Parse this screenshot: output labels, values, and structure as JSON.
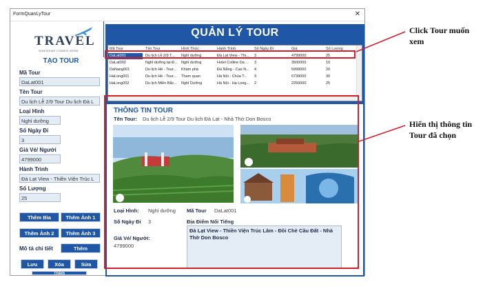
{
  "window": {
    "title": "FormQuanLyTour",
    "close": "✕"
  },
  "logo": {
    "brand": "TRAVEL",
    "tagline": "SUNSHINE COMES HERE"
  },
  "form": {
    "heading": "TẠO TOUR",
    "fields": [
      {
        "label": "Mã Tour",
        "value": "DaLat001"
      },
      {
        "label": "Tên Tour",
        "value": "Du lịch Lễ 2/9 Tour Du lịch Đà L"
      },
      {
        "label": "Loại Hình",
        "value": "Nghỉ dưỡng"
      },
      {
        "label": "Số Ngày Đi",
        "value": "3"
      },
      {
        "label": "Giá Vé/ Người",
        "value": "4799000"
      },
      {
        "label": "Hành Trình",
        "value": "Đà Lạt View - Thiền Viện Trúc L"
      },
      {
        "label": "Số Lượng",
        "value": "25"
      }
    ],
    "buttons": {
      "add_cover": "Thêm Bìa",
      "add_img1": "Thêm Ảnh 1",
      "add_img2": "Thêm Ảnh 2",
      "add_img3": "Thêm Ảnh 3",
      "detail_label": "Mô tả chi tiết",
      "add_detail": "Thêm",
      "save": "Lưu",
      "delete": "Xóa",
      "edit": "Sửa",
      "add": "Thêm"
    }
  },
  "list": {
    "heading": "QUẢN LÝ TOUR",
    "columns": [
      "Mã Tour",
      "Tên Tour",
      "Hình Thức",
      "Hành Trình",
      "Số Ngày Đi",
      "Giá",
      "Số Lượng"
    ],
    "rows": [
      [
        "DaLat001",
        "Du lịch Lễ 2/9 T...",
        "Nghỉ dưỡng",
        "Đà Lạt View - Thi...",
        "3",
        "4799000",
        "25"
      ],
      [
        "DaLat002",
        "Nghỉ dưỡng tại Đ...",
        "Nghỉ dưỡng",
        "Hotel Colline Da ...",
        "3",
        "3500000",
        "10"
      ],
      [
        "DaNang001",
        "Du lịch Hè - Tour...",
        "Khám phá",
        "Đà Nẵng - Cao N...",
        "4",
        "5999000",
        "20"
      ],
      [
        "HaLong001",
        "Du lịch Hè - Tour...",
        "Tham quan",
        "Hà Nội - Chùa T...",
        "3",
        "6739000",
        "30"
      ],
      [
        "HaLong002",
        "Du lịch Miền Bắc...",
        "Nghỉ Dưỡng",
        "Hà Nội - Hạ Long...",
        "2",
        "2250000",
        "25"
      ]
    ]
  },
  "detail": {
    "heading": "THÔNG TIN TOUR",
    "name_label": "Tên Tour:",
    "name_value": "Du lịch Lễ 2/9 Tour Du lịch Đà Lạt - Nhà Thờ Don Bosco",
    "type_label": "Loại Hình:",
    "type_value": "Nghỉ dưỡng",
    "code_label": "Mã Tour",
    "code_value": "DaLat001",
    "days_label": "Số Ngày Đi",
    "days_value": "3",
    "spots_label": "Địa Điểm Nổi Tiếng",
    "spots_value": "Đà Lạt View - Thiền Viện Trúc Lâm - Đồi Chè Cầu Đất - Nhà Thờ Don Bosco",
    "price_label": "Giá Vé/ Người:",
    "price_value": "4799000"
  },
  "annotations": {
    "click": "Click Tour muốn xem",
    "show": "Hiển thị thông tin Tour đã chọn"
  },
  "colors": {
    "panel": "#1f56a6",
    "highlight": "#d21e2b",
    "field": "#e4ecf5"
  }
}
